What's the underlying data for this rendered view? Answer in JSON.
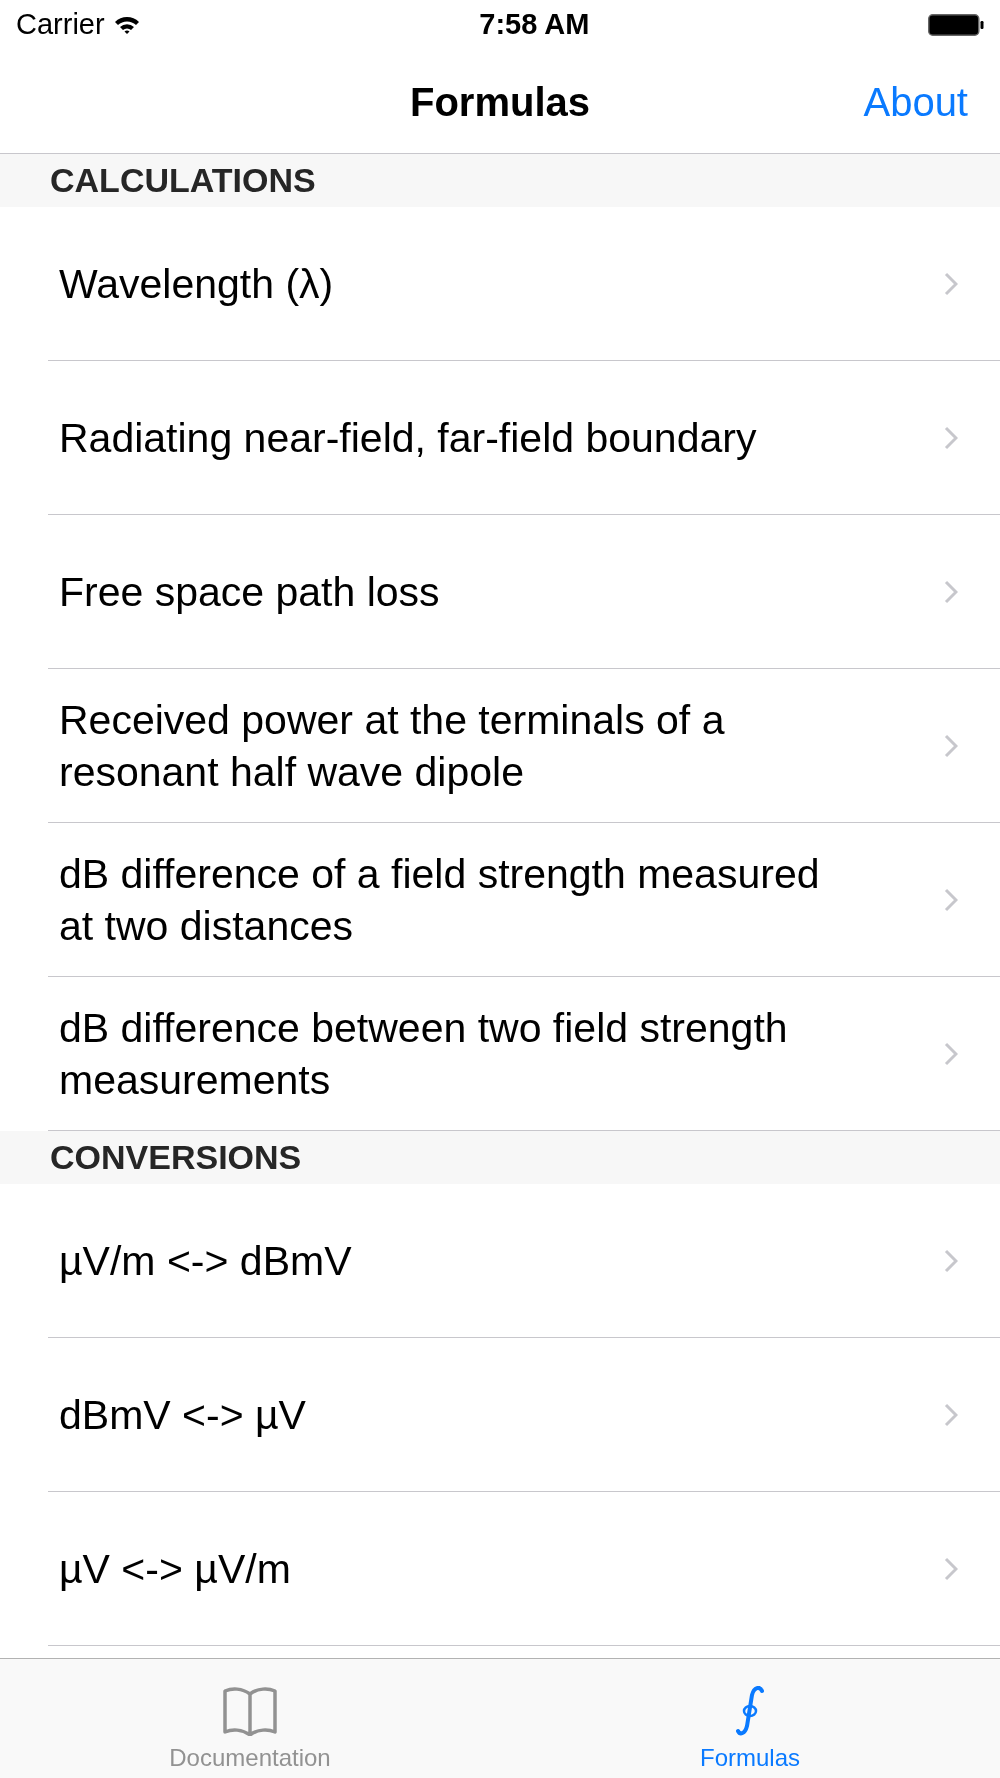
{
  "status_bar": {
    "carrier": "Carrier",
    "time": "7:58 AM"
  },
  "nav_bar": {
    "title": "Formulas",
    "right_button": "About"
  },
  "sections": [
    {
      "header": "CALCULATIONS",
      "rows": [
        "Wavelength (λ)",
        "Radiating near-field, far-field boundary",
        "Free space path loss",
        "Received power at the terminals of a resonant half wave dipole",
        "dB difference of a field strength measured at two distances",
        "dB difference between two field strength measurements"
      ]
    },
    {
      "header": "CONVERSIONS",
      "rows": [
        "µV/m <-> dBmV",
        "dBmV <-> µV",
        "µV <-> µV/m"
      ]
    }
  ],
  "tab_bar": {
    "tabs": [
      {
        "label": "Documentation",
        "kind": "book",
        "selected": false
      },
      {
        "label": "Formulas",
        "kind": "formula",
        "selected": true
      }
    ]
  }
}
